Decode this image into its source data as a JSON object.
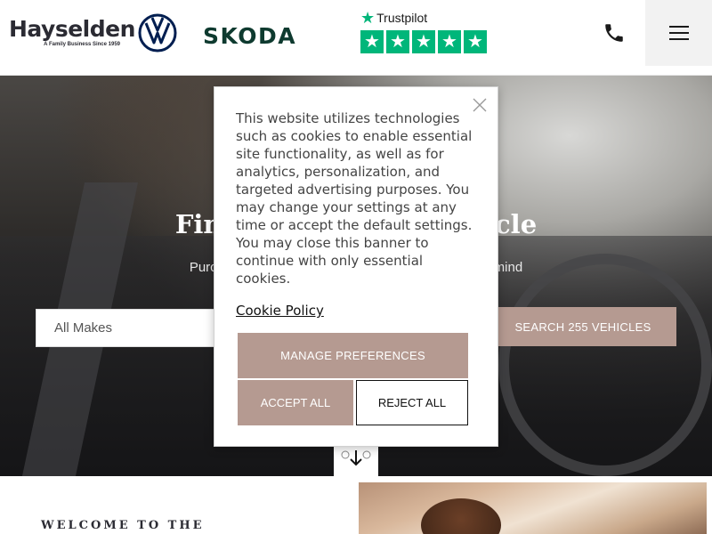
{
  "header": {
    "logo": {
      "name": "Hayselden",
      "tagline": "A Family Business Since 1959"
    },
    "brand_vw": "vw-logo",
    "brand_skoda": "SKODA",
    "trustpilot": {
      "label": "Trustpilot",
      "stars": 5
    },
    "phone_icon": "phone-icon",
    "menu_icon": "hamburger-menu-icon"
  },
  "hero": {
    "title": "Find your perfect vehicle",
    "subtitle": "Purchase your next vehicle with complete peace of mind",
    "search_select": "All Makes",
    "search_button": "SEARCH 255 VEHICLES",
    "scroll_icon": "arrow-down-icon"
  },
  "welcome": {
    "heading": "WELCOME TO THE"
  },
  "cookie_modal": {
    "text": "This website utilizes technologies such as cookies to enable essential site functionality, as well as for analytics, personalization, and targeted advertising purposes. You may change your settings at any time or accept the default settings. You may close this banner to continue with only essential cookies.",
    "policy_link": "Cookie Policy",
    "manage_label": "MANAGE PREFERENCES",
    "accept_label": "ACCEPT ALL",
    "reject_label": "REJECT ALL"
  },
  "colors": {
    "accent": "#b59a91",
    "trustpilot_green": "#00b67a",
    "skoda_green": "#0e3a2f"
  }
}
